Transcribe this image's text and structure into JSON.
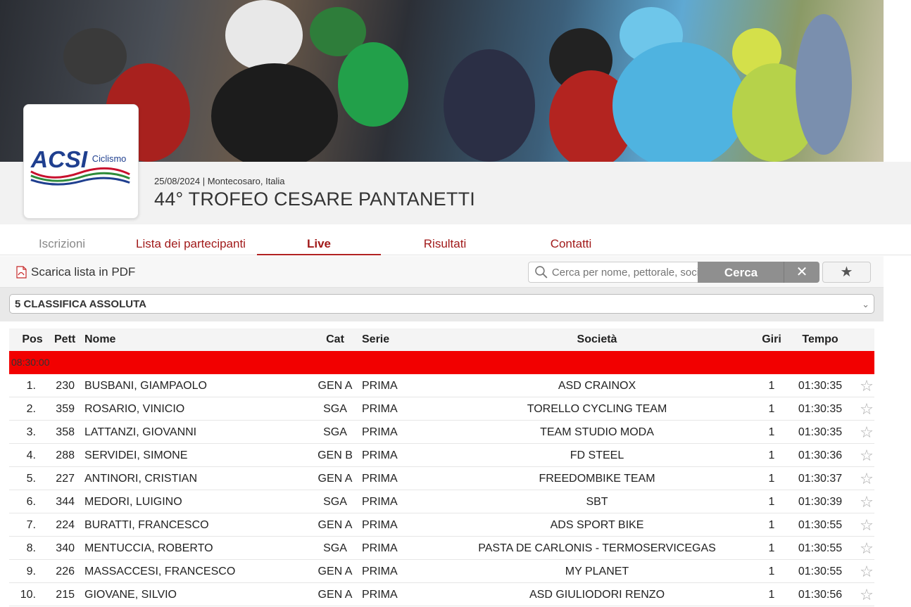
{
  "event": {
    "date": "25/08/2024",
    "location": "Montecosaro, Italia",
    "title": "44° TROFEO CESARE PANTANETTI"
  },
  "logo": {
    "brand": "ACSI",
    "sub": "Ciclismo"
  },
  "tabs": [
    {
      "label": "Iscrizioni"
    },
    {
      "label": "Lista dei partecipanti"
    },
    {
      "label": "Live"
    },
    {
      "label": "Risultati"
    },
    {
      "label": "Contatti"
    }
  ],
  "toolbar": {
    "pdf_label": "Scarica lista in PDF",
    "search_placeholder": "Cerca per nome, pettorale, società",
    "search_button": "Cerca",
    "clear_button": "✕",
    "fav_button": "★"
  },
  "classification": {
    "selected": "5 CLASSIFICA ASSOLUTA"
  },
  "table": {
    "headers": {
      "pos": "Pos",
      "pett": "Pett",
      "nome": "Nome",
      "cat": "Cat",
      "serie": "Serie",
      "societa": "Società",
      "giri": "Giri",
      "tempo": "Tempo"
    },
    "group_label": "08:30:00",
    "rows": [
      {
        "pos": "1.",
        "pett": "230",
        "nome": "BUSBANI, GIAMPAOLO",
        "cat": "GEN A",
        "serie": "PRIMA",
        "societa": "ASD CRAINOX",
        "giri": "1",
        "tempo": "01:30:35"
      },
      {
        "pos": "2.",
        "pett": "359",
        "nome": "ROSARIO, VINICIO",
        "cat": "SGA",
        "serie": "PRIMA",
        "societa": "TORELLO CYCLING TEAM",
        "giri": "1",
        "tempo": "01:30:35"
      },
      {
        "pos": "3.",
        "pett": "358",
        "nome": "LATTANZI, GIOVANNI",
        "cat": "SGA",
        "serie": "PRIMA",
        "societa": "TEAM STUDIO MODA",
        "giri": "1",
        "tempo": "01:30:35"
      },
      {
        "pos": "4.",
        "pett": "288",
        "nome": "SERVIDEI, SIMONE",
        "cat": "GEN B",
        "serie": "PRIMA",
        "societa": "FD STEEL",
        "giri": "1",
        "tempo": "01:30:36"
      },
      {
        "pos": "5.",
        "pett": "227",
        "nome": "ANTINORI, CRISTIAN",
        "cat": "GEN A",
        "serie": "PRIMA",
        "societa": "FREEDOMBIKE TEAM",
        "giri": "1",
        "tempo": "01:30:37"
      },
      {
        "pos": "6.",
        "pett": "344",
        "nome": "MEDORI, LUIGINO",
        "cat": "SGA",
        "serie": "PRIMA",
        "societa": "SBT",
        "giri": "1",
        "tempo": "01:30:39"
      },
      {
        "pos": "7.",
        "pett": "224",
        "nome": "BURATTI, FRANCESCO",
        "cat": "GEN A",
        "serie": "PRIMA",
        "societa": "ADS SPORT BIKE",
        "giri": "1",
        "tempo": "01:30:55"
      },
      {
        "pos": "8.",
        "pett": "340",
        "nome": "MENTUCCIA, ROBERTO",
        "cat": "SGA",
        "serie": "PRIMA",
        "societa": "PASTA DE CARLONIS - TERMOSERVICEGAS",
        "giri": "1",
        "tempo": "01:30:55"
      },
      {
        "pos": "9.",
        "pett": "226",
        "nome": "MASSACCESI, FRANCESCO",
        "cat": "GEN A",
        "serie": "PRIMA",
        "societa": "MY PLANET",
        "giri": "1",
        "tempo": "01:30:55"
      },
      {
        "pos": "10.",
        "pett": "215",
        "nome": "GIOVANE, SILVIO",
        "cat": "GEN A",
        "serie": "PRIMA",
        "societa": "ASD GIULIODORI RENZO",
        "giri": "1",
        "tempo": "01:30:56"
      }
    ]
  }
}
